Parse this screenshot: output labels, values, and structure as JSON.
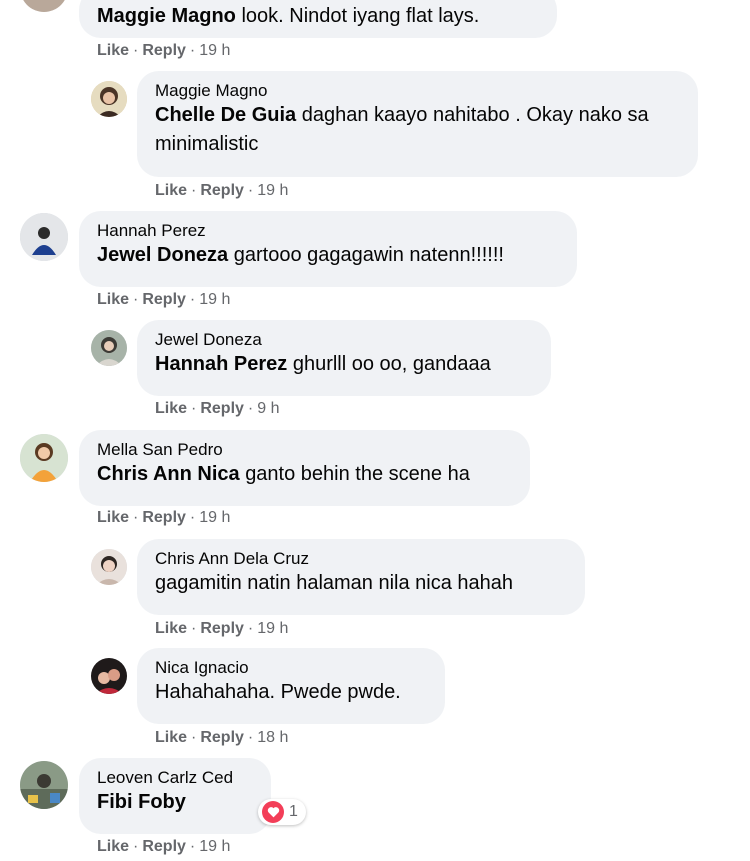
{
  "comments": [
    {
      "author_inline": "Maggie Magno",
      "text": "look. Nindot iyang flat lays.",
      "like": "Like",
      "reply": "Reply",
      "time": "19 h"
    },
    {
      "author": "Maggie Magno",
      "mention": "Chelle De Guia",
      "text": "daghan kaayo nahitabo . Okay nako sa minimalistic",
      "like": "Like",
      "reply": "Reply",
      "time": "19 h"
    },
    {
      "author": "Hannah Perez",
      "mention": "Jewel Doneza",
      "text": "gartooo gagagawin natenn!!!!!!",
      "like": "Like",
      "reply": "Reply",
      "time": "19 h"
    },
    {
      "author": "Jewel Doneza",
      "mention": "Hannah Perez",
      "text": "ghurlll oo oo, gandaaa",
      "like": "Like",
      "reply": "Reply",
      "time": "9 h"
    },
    {
      "author": "Mella San Pedro",
      "mention": "Chris Ann Nica",
      "text": "ganto behin the scene ha",
      "like": "Like",
      "reply": "Reply",
      "time": "19 h"
    },
    {
      "author": "Chris Ann Dela Cruz",
      "text": "gagamitin natin halaman nila nica hahah",
      "like": "Like",
      "reply": "Reply",
      "time": "19 h"
    },
    {
      "author": "Nica Ignacio",
      "text": "Hahahahaha. Pwede pwde.",
      "like": "Like",
      "reply": "Reply",
      "time": "18 h"
    },
    {
      "author": "Leoven Carlz Ced",
      "mention": "Fibi Foby",
      "like": "Like",
      "reply": "Reply",
      "time": "19 h",
      "reaction_icon": "heart-icon",
      "reaction_count": "1"
    }
  ],
  "colors": {
    "bubble": "#f0f2f5",
    "meta": "#65676b",
    "reaction_heart": "#f33e58"
  }
}
